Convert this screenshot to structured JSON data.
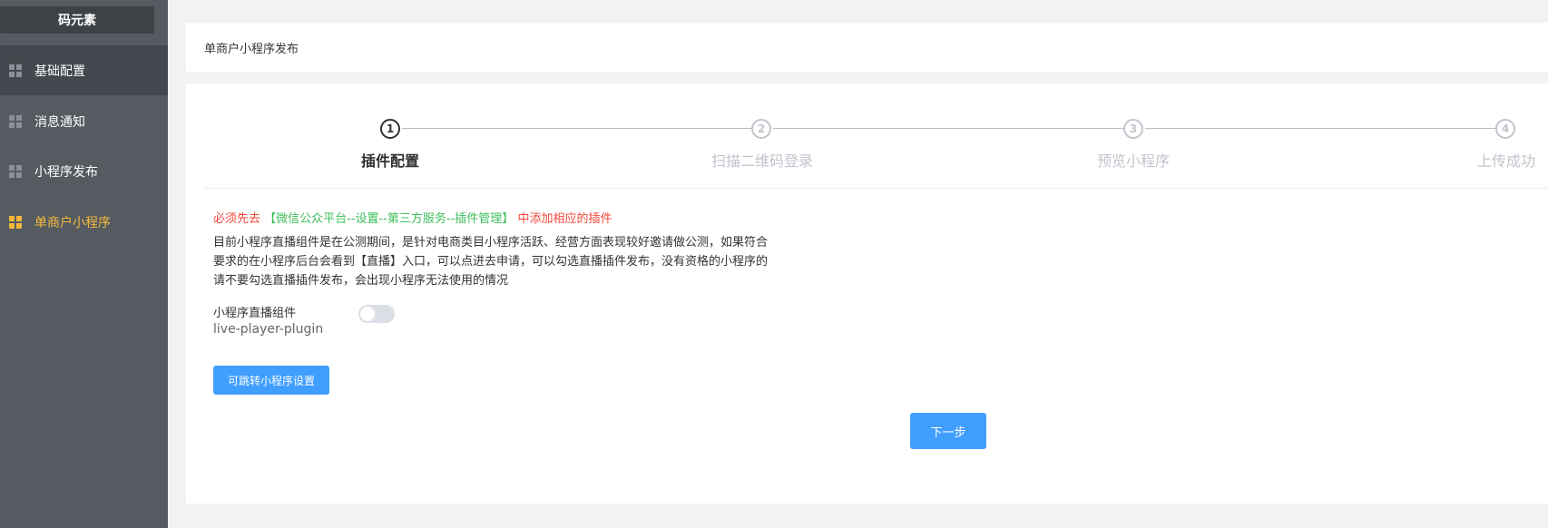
{
  "sidebar": {
    "brand": "码元素",
    "items": [
      {
        "label": "基础配置",
        "icon": "grid-icon"
      },
      {
        "label": "消息通知",
        "icon": "grid-icon"
      },
      {
        "label": "小程序发布",
        "icon": "grid-icon"
      },
      {
        "label": "单商户小程序",
        "icon": "grid-icon"
      }
    ]
  },
  "header": {
    "title": "单商户小程序发布"
  },
  "steps": [
    {
      "number": "1",
      "title": "插件配置"
    },
    {
      "number": "2",
      "title": "扫描二维码登录"
    },
    {
      "number": "3",
      "title": "预览小程序"
    },
    {
      "number": "4",
      "title": "上传成功"
    }
  ],
  "notice": {
    "prefix": "必须先去",
    "path": "【微信公众平台--设置--第三方服务--插件管理】",
    "suffix": "中添加相应的插件"
  },
  "description": "目前小程序直播组件是在公测期间，是针对电商类目小程序活跃、经营方面表现较好邀请做公测，如果符合要求的在小程序后台会看到【直播】入口，可以点进去申请，可以勾选直播插件发布，没有资格的小程序的请不要勾选直播插件发布，会出现小程序无法使用的情况",
  "plugin": {
    "label": "小程序直播组件",
    "name": "live-player-plugin",
    "enabled": false
  },
  "buttons": {
    "jump": "可跳转小程序设置",
    "next": "下一步"
  },
  "colors": {
    "accent": "#409eff",
    "active_nav": "#f5b93a",
    "warn_red": "#f0493c",
    "warn_green": "#3fbf5c"
  }
}
